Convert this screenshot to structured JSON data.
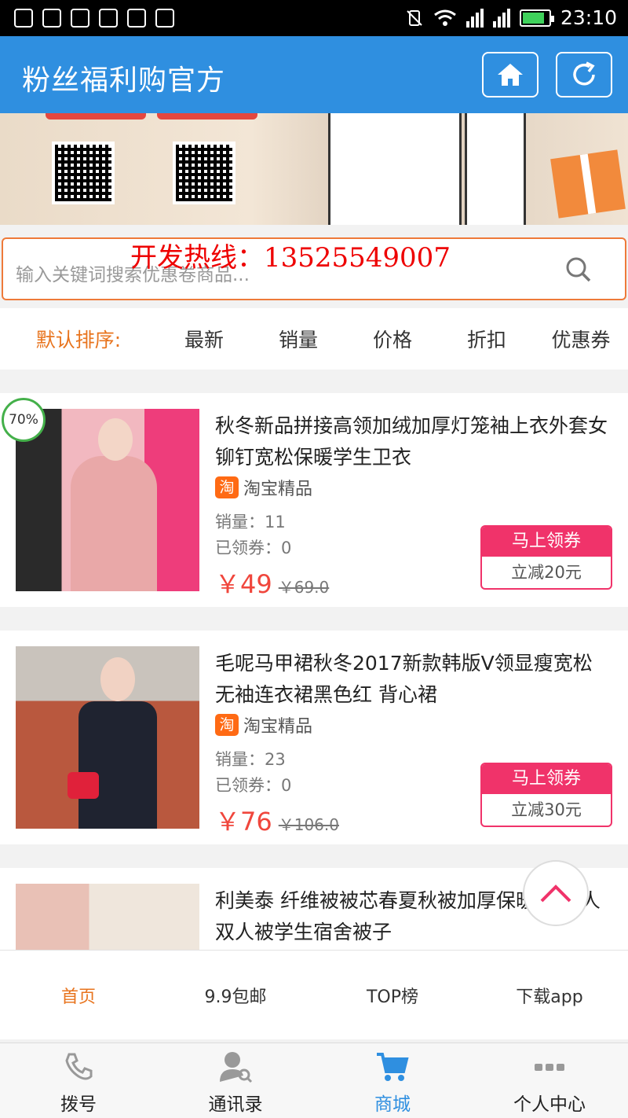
{
  "status_bar": {
    "time": "23:10",
    "battery_level": 0.85
  },
  "header": {
    "title": "粉丝福利购官方"
  },
  "search": {
    "placeholder": "输入关键词搜索优惠卷商品...",
    "hotline": "开发热线：13525549007"
  },
  "sort": {
    "label": "默认排序:",
    "items": [
      "最新",
      "销量",
      "价格",
      "折扣",
      "优惠券"
    ]
  },
  "products": [
    {
      "title": "秋冬新品拼接高领加绒加厚灯笼袖上衣外套女铆钉宽松保暖学生卫衣",
      "platform": "淘宝精品",
      "platform_badge": "淘",
      "sales": "销量：11",
      "claimed": "已领券：0",
      "price": "￥49",
      "old_price": "￥69.0",
      "coupon_label": "马上领券",
      "coupon_value": "立减20元",
      "percent": "70%"
    },
    {
      "title": "毛呢马甲裙秋冬2017新款韩版V领显瘦宽松无袖连衣裙黑色红 背心裙",
      "platform": "淘宝精品",
      "platform_badge": "淘",
      "sales": "销量：23",
      "claimed": "已领券：0",
      "price": "￥76",
      "old_price": "￥106.0",
      "coupon_label": "马上领券",
      "coupon_value": "立减30元"
    },
    {
      "title": "利美泰 纤维被被芯春夏秋被加厚保暖 大单人双人被学生宿舍被子"
    }
  ],
  "subnav": [
    "首页",
    "9.9包邮",
    "TOP榜",
    "下载app"
  ],
  "tabbar": [
    "拨号",
    "通讯录",
    "商城",
    "个人中心"
  ],
  "colors": {
    "header": "#2f8fe0",
    "accent": "#e8741e",
    "coupon": "#f0336a",
    "price": "#f0463c"
  }
}
